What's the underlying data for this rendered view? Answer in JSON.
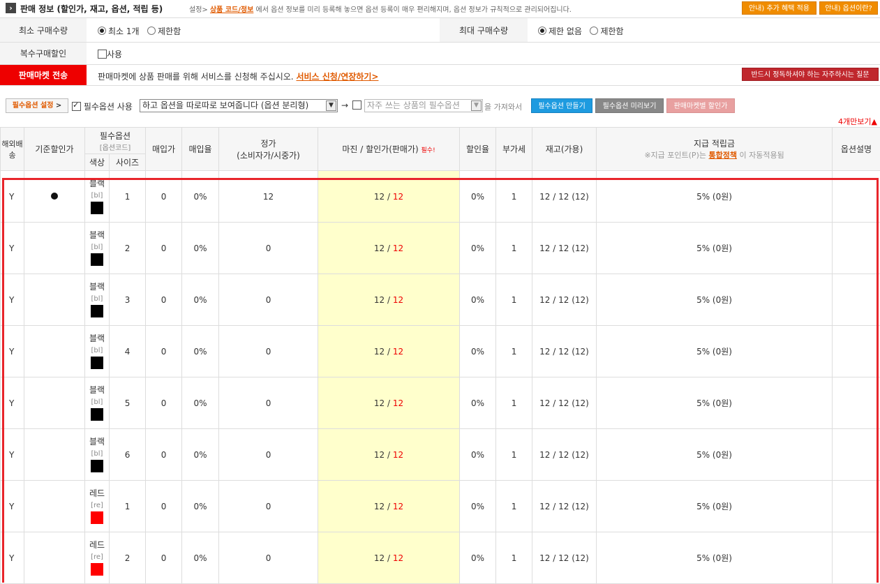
{
  "header": {
    "title": "판매 정보 (할인가, 재고, 옵션, 적립 등)",
    "sub_prefix": "설정>",
    "sub_link": "상품 코드/정보",
    "sub_suffix": "에서 옵션 정보를 미리 등록해 놓으면 옵션 등록이 매우 편리해지며, 옵션 정보가 규칙적으로 관리되어집니다.",
    "btn_benefit": "안내) 추가 혜택 적용",
    "btn_option": "안내) 옵션이란?"
  },
  "purchase": {
    "min_label": "최소 구매수량",
    "min_opt1": "최소 1개",
    "min_opt2": "제한함",
    "max_label": "최대 구매수량",
    "max_opt1": "제한 없음",
    "max_opt2": "제한함",
    "multi_label": "복수구매할인",
    "multi_check": "사용"
  },
  "market": {
    "label": "판매마켓 전송",
    "text": "판매마켓에 상품 판매를 위해 서비스를 신청해 주십시오.",
    "link": "서비스 신청/연장하기>",
    "faq": "반드시 정독하셔야 하는 자주하시는 질문"
  },
  "optbar": {
    "setting_label": "필수옵션 설정",
    "setting_arrow": ">",
    "use_label": "필수옵션 사용",
    "mode_select": "하고 옵션을 따로따로 보여줍니다 (옵션 분리형)",
    "arrow": "→",
    "freq_select": "자주 쓰는 상품의 필수옵션",
    "bring": "을 가져와서",
    "btn_make": "필수옵션 만들기",
    "btn_preview": "필수옵션 미리보기",
    "btn_market": "판매마켓별 할인가"
  },
  "more_link": "4개만보기▲",
  "table": {
    "h_overseas": "해외배송",
    "h_base": "기준할인가",
    "h_required": "필수옵션",
    "h_required_sub": "[옵션코드]",
    "h_color": "색상",
    "h_size": "사이즈",
    "h_buy": "매입가",
    "h_buyrate": "매입율",
    "h_list": "정가",
    "h_list_sub": "(소비자가/시중가)",
    "h_margin": "마진 / 할인가(판매가)",
    "h_must": "필수!",
    "h_disc": "할인율",
    "h_vat": "부가세",
    "h_stock": "재고(가용)",
    "h_points": "지급 적립금",
    "h_points_sub_pre": "※지급 포인트(P)는",
    "h_points_link": "통합정책",
    "h_points_sub_post": "이 자동적용됨",
    "h_desc": "옵션설명",
    "rows": [
      {
        "ship": "Y",
        "base": true,
        "color": "블랙",
        "code": "[bl]",
        "swatch": "#000000",
        "size": "1",
        "buy": "0",
        "rate": "0%",
        "list": "12",
        "margin": "12 /",
        "price": "12",
        "disc": "0%",
        "vat": "1",
        "stock": "12 / 12 (12)",
        "points": "5% (0원)"
      },
      {
        "ship": "Y",
        "base": false,
        "color": "블랙",
        "code": "[bl]",
        "swatch": "#000000",
        "size": "2",
        "buy": "0",
        "rate": "0%",
        "list": "0",
        "margin": "12 /",
        "price": "12",
        "disc": "0%",
        "vat": "1",
        "stock": "12 / 12 (12)",
        "points": "5% (0원)"
      },
      {
        "ship": "Y",
        "base": false,
        "color": "블랙",
        "code": "[bl]",
        "swatch": "#000000",
        "size": "3",
        "buy": "0",
        "rate": "0%",
        "list": "0",
        "margin": "12 /",
        "price": "12",
        "disc": "0%",
        "vat": "1",
        "stock": "12 / 12 (12)",
        "points": "5% (0원)"
      },
      {
        "ship": "Y",
        "base": false,
        "color": "블랙",
        "code": "[bl]",
        "swatch": "#000000",
        "size": "4",
        "buy": "0",
        "rate": "0%",
        "list": "0",
        "margin": "12 /",
        "price": "12",
        "disc": "0%",
        "vat": "1",
        "stock": "12 / 12 (12)",
        "points": "5% (0원)"
      },
      {
        "ship": "Y",
        "base": false,
        "color": "블랙",
        "code": "[bl]",
        "swatch": "#000000",
        "size": "5",
        "buy": "0",
        "rate": "0%",
        "list": "0",
        "margin": "12 /",
        "price": "12",
        "disc": "0%",
        "vat": "1",
        "stock": "12 / 12 (12)",
        "points": "5% (0원)"
      },
      {
        "ship": "Y",
        "base": false,
        "color": "블랙",
        "code": "[bl]",
        "swatch": "#000000",
        "size": "6",
        "buy": "0",
        "rate": "0%",
        "list": "0",
        "margin": "12 /",
        "price": "12",
        "disc": "0%",
        "vat": "1",
        "stock": "12 / 12 (12)",
        "points": "5% (0원)"
      },
      {
        "ship": "Y",
        "base": false,
        "color": "레드",
        "code": "[re]",
        "swatch": "#ff0000",
        "size": "1",
        "buy": "0",
        "rate": "0%",
        "list": "0",
        "margin": "12 /",
        "price": "12",
        "disc": "0%",
        "vat": "1",
        "stock": "12 / 12 (12)",
        "points": "5% (0원)"
      },
      {
        "ship": "Y",
        "base": false,
        "color": "레드",
        "code": "[re]",
        "swatch": "#ff0000",
        "size": "2",
        "buy": "0",
        "rate": "0%",
        "list": "0",
        "margin": "12 /",
        "price": "12",
        "disc": "0%",
        "vat": "1",
        "stock": "12 / 12 (12)",
        "points": "5% (0원)"
      }
    ]
  }
}
